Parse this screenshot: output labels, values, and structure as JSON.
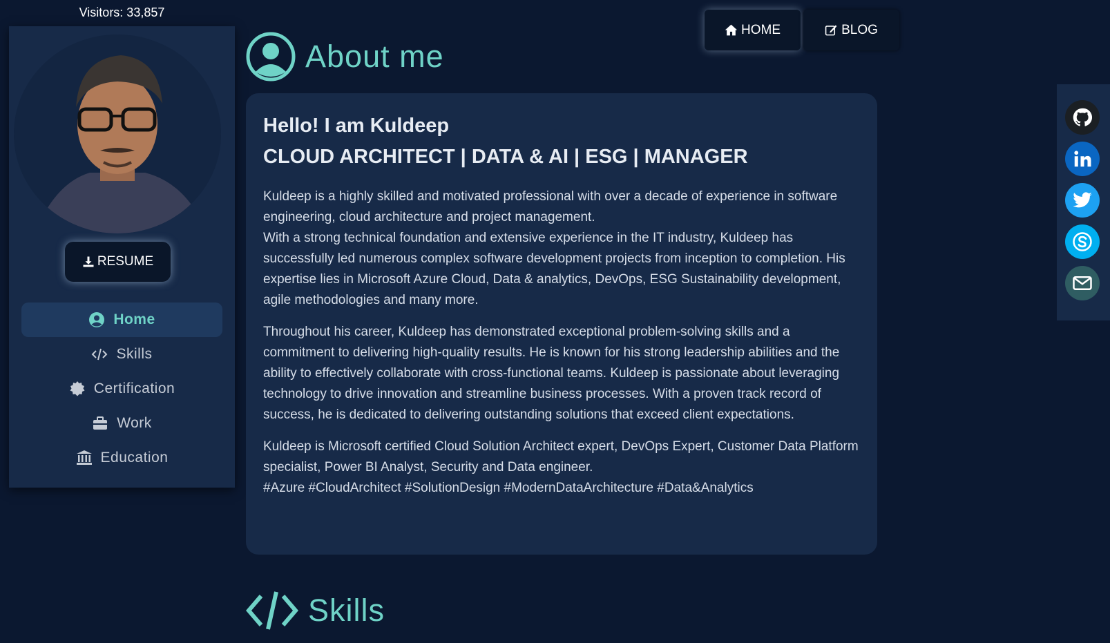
{
  "sidebar": {
    "visitors": "Visitors: 33,857",
    "resume_label": "RESUME",
    "nav": [
      {
        "label": "Home",
        "icon": "user-circle-icon",
        "active": true
      },
      {
        "label": "Skills",
        "icon": "code-icon",
        "active": false
      },
      {
        "label": "Certification",
        "icon": "certificate-icon",
        "active": false
      },
      {
        "label": "Work",
        "icon": "briefcase-icon",
        "active": false
      },
      {
        "label": "Education",
        "icon": "university-icon",
        "active": false
      }
    ]
  },
  "header": {
    "home_label": "HOME",
    "blog_label": "BLOG"
  },
  "about": {
    "heading": "About me",
    "hello": "Hello! I am Kuldeep",
    "role": "CLOUD ARCHITECT | DATA & AI | ESG | MANAGER",
    "paragraph1a": "Kuldeep is a highly skilled and motivated professional with over a decade of experience in software engineering, cloud architecture and project management.",
    "paragraph1b": "With a strong technical foundation and extensive experience in the IT industry, Kuldeep has successfully led numerous complex software development projects from inception to completion. His expertise lies in Microsoft Azure Cloud, Data & analytics, DevOps, ESG Sustainability development, agile methodologies and many more.",
    "paragraph2": "Throughout his career, Kuldeep has demonstrated exceptional problem-solving skills and a commitment to delivering high-quality results. He is known for his strong leadership abilities and the ability to effectively collaborate with cross-functional teams. Kuldeep is passionate about leveraging technology to drive innovation and streamline business processes. With a proven track record of success, he is dedicated to delivering outstanding solutions that exceed client expectations.",
    "paragraph3": "Kuldeep is Microsoft certified Cloud Solution Architect expert, DevOps Expert, Customer Data Platform specialist, Power BI Analyst, Security and Data engineer.",
    "hashtags": "#Azure #CloudArchitect #SolutionDesign #ModernDataArchitecture #Data&Analytics"
  },
  "skills": {
    "heading": "Skills"
  },
  "social": [
    {
      "icon": "github-icon",
      "color": "#1b1f23"
    },
    {
      "icon": "linkedin-icon",
      "color": "#0a66c2"
    },
    {
      "icon": "twitter-icon",
      "color": "#1da1f2"
    },
    {
      "icon": "skype-icon",
      "color": "#00aff0"
    },
    {
      "icon": "email-icon",
      "color": "#2f5d62"
    }
  ],
  "colors": {
    "background": "#0b1830",
    "panel": "#172a48",
    "accent": "#6fd3c7",
    "active_nav": "#1f3a5f"
  }
}
